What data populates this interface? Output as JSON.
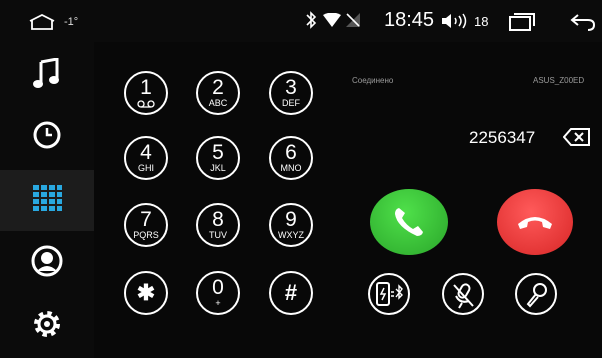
{
  "status_bar": {
    "temperature": "-1°",
    "time": "18:45",
    "volume": "18",
    "icons": [
      "home-icon",
      "bluetooth-icon",
      "wifi-icon",
      "no-signal-icon",
      "volume-icon",
      "recent-apps-icon",
      "back-icon"
    ]
  },
  "sidebar": {
    "items": [
      {
        "name": "music",
        "icon": "music-note-icon",
        "active": false
      },
      {
        "name": "recents",
        "icon": "clock-icon",
        "active": false
      },
      {
        "name": "dialpad",
        "icon": "dialpad-grid-icon",
        "active": true
      },
      {
        "name": "contacts",
        "icon": "contact-icon",
        "active": false
      },
      {
        "name": "settings",
        "icon": "gear-icon",
        "active": false
      }
    ]
  },
  "dialpad": {
    "keys": [
      {
        "digit": "1",
        "sub": ""
      },
      {
        "digit": "2",
        "sub": "ABC"
      },
      {
        "digit": "3",
        "sub": "DEF"
      },
      {
        "digit": "4",
        "sub": "GHI"
      },
      {
        "digit": "5",
        "sub": "JKL"
      },
      {
        "digit": "6",
        "sub": "MNO"
      },
      {
        "digit": "7",
        "sub": "PQRS"
      },
      {
        "digit": "8",
        "sub": "TUV"
      },
      {
        "digit": "9",
        "sub": "WXYZ"
      },
      {
        "digit": "✱",
        "sub": ""
      },
      {
        "digit": "0",
        "sub": "+"
      },
      {
        "digit": "#",
        "sub": ""
      }
    ]
  },
  "call": {
    "status": "Соединено",
    "device": "ASUS_Z00ED",
    "number": "2256347"
  },
  "colors": {
    "call_green": "#3cc63a",
    "end_red": "#e63333",
    "active_accent": "#29a8e0"
  }
}
